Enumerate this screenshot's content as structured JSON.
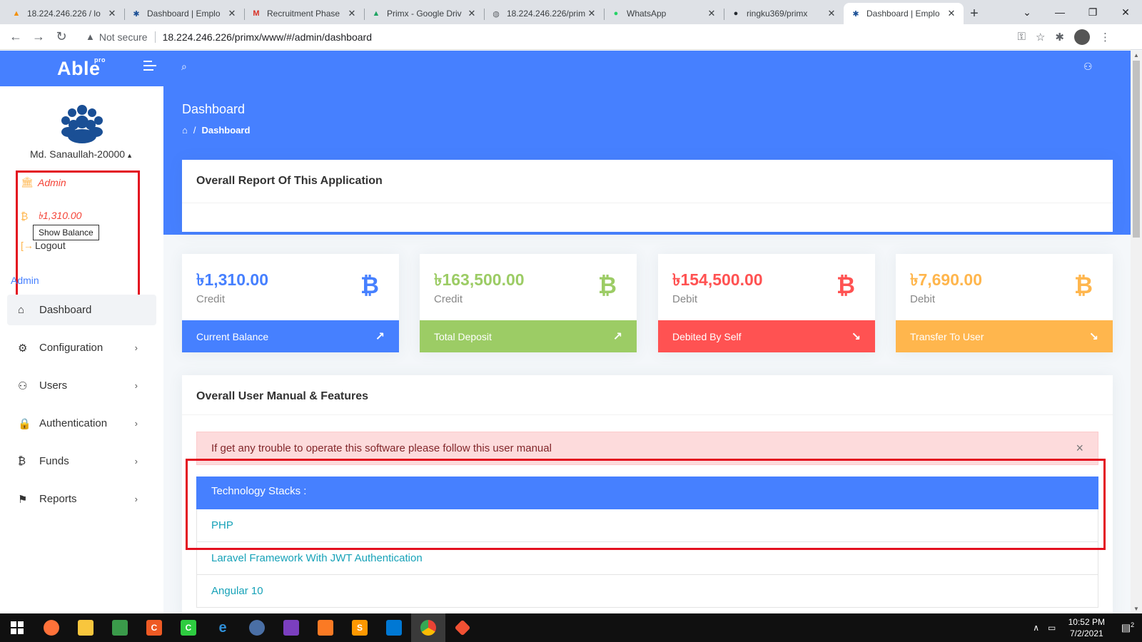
{
  "browser": {
    "tabs": [
      {
        "title": "18.224.246.226 / lo",
        "icon": "pma-icon",
        "color": "#f29111"
      },
      {
        "title": "Dashboard | Emplo",
        "icon": "people-icon",
        "color": "#1a4f95"
      },
      {
        "title": "Recruitment Phase",
        "icon": "gmail-icon",
        "color": "#d93025"
      },
      {
        "title": "Primx - Google Driv",
        "icon": "drive-icon",
        "color": "#1fa463"
      },
      {
        "title": "18.224.246.226/prim",
        "icon": "globe-icon",
        "color": "#5f6368"
      },
      {
        "title": "WhatsApp",
        "icon": "whatsapp-icon",
        "color": "#25d366"
      },
      {
        "title": "ringku369/primx",
        "icon": "github-icon",
        "color": "#24292e"
      },
      {
        "title": "Dashboard | Emplo",
        "icon": "people-icon",
        "color": "#1a4f95",
        "active": true
      }
    ],
    "security_label": "Not secure",
    "url": "18.224.246.226/primx/www/#/admin/dashboard"
  },
  "app": {
    "logo": "Able",
    "logo_sup": "pro",
    "primary_color": "#4680ff"
  },
  "sidebar": {
    "user_name": "Md. Sanaullah-20000",
    "role": "Admin",
    "balance": "৳1,310.00",
    "tooltip": "Show Balance",
    "logout": "Logout",
    "caption": "Admin",
    "menu": [
      {
        "label": "Dashboard",
        "icon": "home-icon",
        "active": true,
        "arrow": false
      },
      {
        "label": "Configuration",
        "icon": "gear-icon",
        "arrow": true
      },
      {
        "label": "Users",
        "icon": "users-icon",
        "arrow": true
      },
      {
        "label": "Authentication",
        "icon": "lock-icon",
        "arrow": true
      },
      {
        "label": "Funds",
        "icon": "bitcoin-icon",
        "arrow": true
      },
      {
        "label": "Reports",
        "icon": "flag-icon",
        "arrow": true
      }
    ]
  },
  "header": {
    "title": "Dashboard",
    "breadcrumb_current": "Dashboard"
  },
  "report": {
    "title": "Overall Report Of This Application"
  },
  "stats": [
    {
      "amount": "৳1,310.00",
      "sub": "Credit",
      "footer": "Current Balance",
      "color": "#4680ff",
      "trend": "up"
    },
    {
      "amount": "৳163,500.00",
      "sub": "Credit",
      "footer": "Total Deposit",
      "color": "#9ccc65",
      "trend": "up"
    },
    {
      "amount": "৳154,500.00",
      "sub": "Debit",
      "footer": "Debited By Self",
      "color": "#ff5252",
      "trend": "down"
    },
    {
      "amount": "৳7,690.00",
      "sub": "Debit",
      "footer": "Transfer To User",
      "color": "#ffb64d",
      "trend": "down"
    }
  ],
  "manual": {
    "title": "Overall User Manual & Features",
    "alert": "If get any trouble to operate this software please follow this user manual",
    "list_header": "Technology Stacks :",
    "items": [
      "PHP",
      "Laravel Framework With JWT Authentication",
      "Angular 10"
    ]
  },
  "taskbar": {
    "time": "10:52 PM",
    "date": "7/2/2021",
    "notifications": "2"
  }
}
